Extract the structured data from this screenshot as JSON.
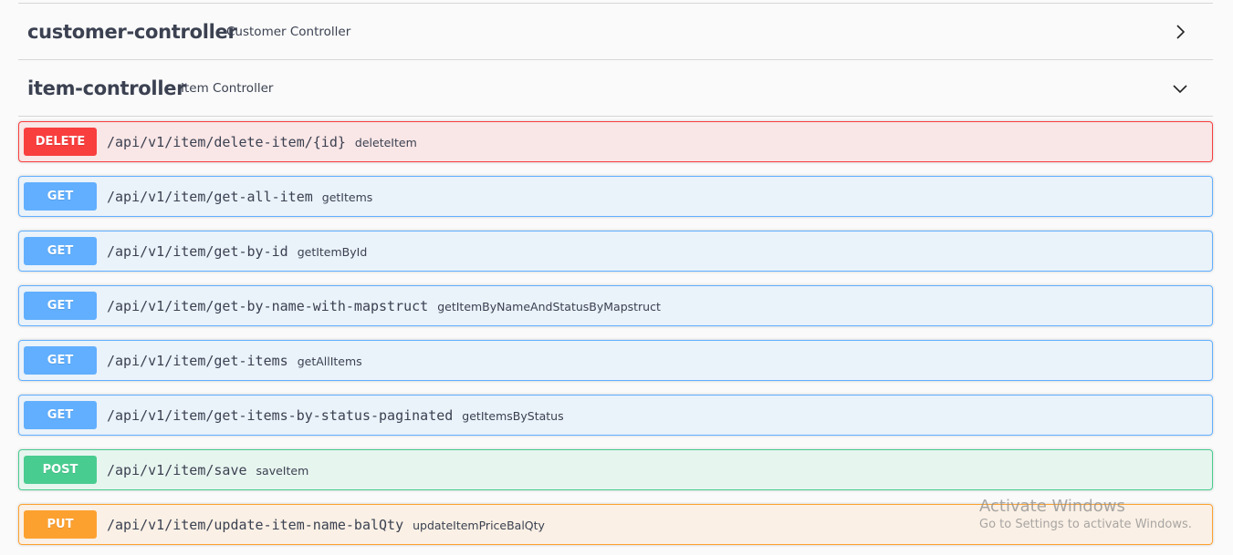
{
  "tags": [
    {
      "name": "customer-controller",
      "description": "Customer Controller",
      "expanded": false,
      "icon": "chevron-right-icon"
    },
    {
      "name": "item-controller",
      "description": "Item Controller",
      "expanded": true,
      "icon": "chevron-down-icon"
    }
  ],
  "operations": [
    {
      "method": "DELETE",
      "path": "/api/v1/item/delete-item/{id}",
      "summary": "deleteItem"
    },
    {
      "method": "GET",
      "path": "/api/v1/item/get-all-item",
      "summary": "getItems"
    },
    {
      "method": "GET",
      "path": "/api/v1/item/get-by-id",
      "summary": "getItemById"
    },
    {
      "method": "GET",
      "path": "/api/v1/item/get-by-name-with-mapstruct",
      "summary": "getItemByNameAndStatusByMapstruct"
    },
    {
      "method": "GET",
      "path": "/api/v1/item/get-items",
      "summary": "getAllItems"
    },
    {
      "method": "GET",
      "path": "/api/v1/item/get-items-by-status-paginated",
      "summary": "getItemsByStatus"
    },
    {
      "method": "POST",
      "path": "/api/v1/item/save",
      "summary": "saveItem"
    },
    {
      "method": "PUT",
      "path": "/api/v1/item/update-item-name-balQty",
      "summary": "updateItemPriceBalQty"
    }
  ],
  "colors": {
    "delete": "#f93e3e",
    "get": "#61affe",
    "post": "#49cc90",
    "put": "#fca130"
  },
  "watermark": {
    "title": "Activate Windows",
    "subtitle": "Go to Settings to activate Windows."
  }
}
